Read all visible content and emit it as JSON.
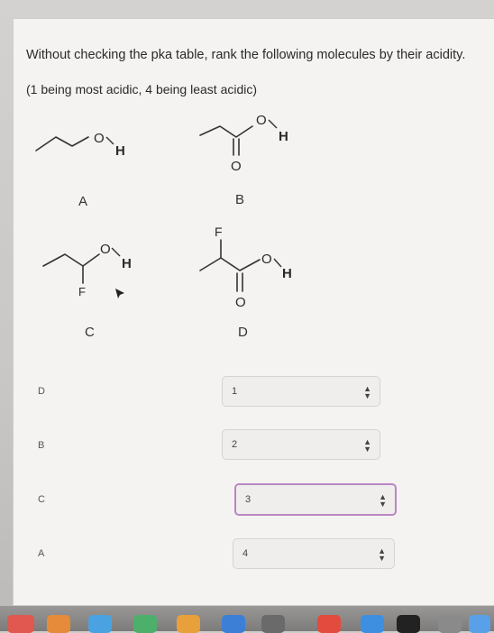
{
  "question": {
    "text": "Without checking the pka table, rank the following molecules by their acidity.",
    "instruction": "(1 being most acidic, 4 being least acidic)"
  },
  "molecules": [
    {
      "label": "A",
      "atoms": [
        "O",
        "H"
      ]
    },
    {
      "label": "B",
      "atoms": [
        "O",
        "H",
        "O"
      ]
    },
    {
      "label": "C",
      "atoms": [
        "O",
        "H",
        "F"
      ]
    },
    {
      "label": "D",
      "atoms": [
        "F",
        "O",
        "H",
        "O"
      ]
    }
  ],
  "ranking": [
    {
      "molecule": "D",
      "rank": "1"
    },
    {
      "molecule": "B",
      "rank": "2"
    },
    {
      "molecule": "C",
      "rank": "3"
    },
    {
      "molecule": "A",
      "rank": "4"
    }
  ],
  "icons": {
    "select_arrows": "up-down-chevron-icon"
  },
  "colors": {
    "focus_border": "#b987c4",
    "card_background": "#f4f3f1"
  }
}
